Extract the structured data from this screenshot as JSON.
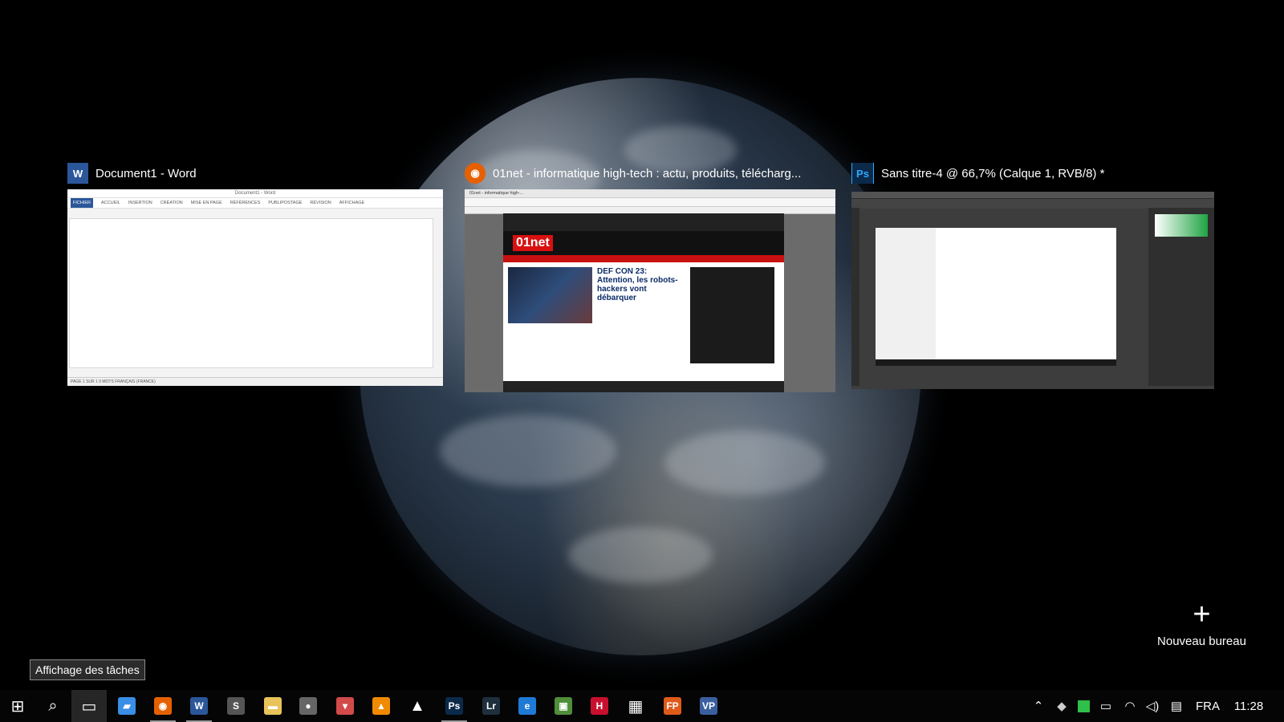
{
  "windows": [
    {
      "title": "Document1 - Word",
      "icon": "word-icon",
      "icon_glyph": "W",
      "color": "#2b579a"
    },
    {
      "title": "01net - informatique high-tech : actu, produits, télécharg...",
      "icon": "firefox-icon",
      "icon_glyph": "◉",
      "color": "#e66000"
    },
    {
      "title": "Sans titre-4 @ 66,7% (Calque 1, RVB/8) *",
      "icon": "photoshop-icon",
      "icon_glyph": "Ps",
      "color": "#0b2a4a"
    }
  ],
  "word_thumb": {
    "doc_title": "Document1 - Word",
    "tabs": [
      "FICHIER",
      "ACCUEIL",
      "INSERTION",
      "CRÉATION",
      "MISE EN PAGE",
      "RÉFÉRENCES",
      "PUBLIPOSTAGE",
      "RÉVISION",
      "AFFICHAGE"
    ],
    "status": "PAGE 1 SUR 1    0 MOTS    FRANÇAIS (FRANCE)"
  },
  "ff_thumb": {
    "tab": "01net - informatique high-...",
    "logo": "01net",
    "headline": "DEF CON 23: Attention, les robots-hackers vont débarquer"
  },
  "new_desktop": {
    "label": "Nouveau bureau"
  },
  "tooltip": "Affichage des tâches",
  "taskbar": {
    "items": [
      {
        "name": "start-icon",
        "glyph": "⊞",
        "color": "#ffffff"
      },
      {
        "name": "search-icon",
        "glyph": "⌕",
        "color": "#ffffff"
      },
      {
        "name": "task-view-icon",
        "glyph": "▭",
        "color": "#ffffff"
      },
      {
        "name": "file-explorer-pin-icon",
        "glyph": "▰",
        "color": "#3a8ee6"
      },
      {
        "name": "firefox-icon",
        "glyph": "◉",
        "color": "#e66000"
      },
      {
        "name": "word-icon",
        "glyph": "W",
        "color": "#2b579a"
      },
      {
        "name": "app-s-icon",
        "glyph": "S",
        "color": "#555555"
      },
      {
        "name": "folder-icon",
        "glyph": "▬",
        "color": "#e8c35a"
      },
      {
        "name": "camera-app-icon",
        "glyph": "●",
        "color": "#666666"
      },
      {
        "name": "popcorn-icon",
        "glyph": "▾",
        "color": "#d24a4a"
      },
      {
        "name": "vlc-icon",
        "glyph": "▲",
        "color": "#f08a00"
      },
      {
        "name": "cone-icon",
        "glyph": "▲",
        "color": "#ffffff"
      },
      {
        "name": "photoshop-icon",
        "glyph": "Ps",
        "color": "#0b2a4a"
      },
      {
        "name": "lightroom-icon",
        "glyph": "Lr",
        "color": "#1e2f3e"
      },
      {
        "name": "edge-icon",
        "glyph": "e",
        "color": "#1f7ad6"
      },
      {
        "name": "app-green-icon",
        "glyph": "▣",
        "color": "#4f8f3a"
      },
      {
        "name": "app-red-circle-icon",
        "glyph": "H",
        "color": "#c8102e"
      },
      {
        "name": "store-icon",
        "glyph": "▦",
        "color": "#ffffff"
      },
      {
        "name": "fp-app-icon",
        "glyph": "FP",
        "color": "#e05a1a"
      },
      {
        "name": "vp-app-icon",
        "glyph": "VP",
        "color": "#3a5fa0"
      }
    ],
    "tray": {
      "language": "FRA",
      "time": "11:28"
    }
  }
}
